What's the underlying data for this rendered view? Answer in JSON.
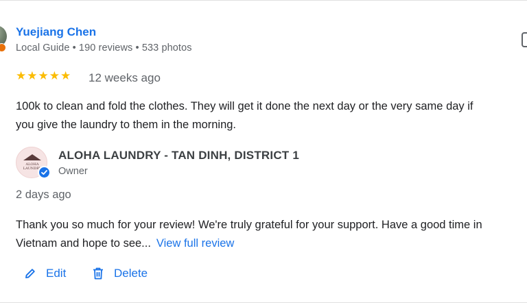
{
  "reviewer": {
    "name": "Yuejiang Chen",
    "meta": "Local Guide • 190 reviews • 533 photos"
  },
  "review": {
    "stars": "★★★★★",
    "rating": 5,
    "time": "12 weeks ago",
    "text_line1": "100k to clean and fold the clothes. They will get it done the next day or the very same day if",
    "text_line2": "you give the laundry to them in the morning."
  },
  "owner_reply": {
    "name": "ALOHA LAUNDRY - TAN DINH, DISTRICT 1",
    "role": "Owner",
    "logo_text": "ALOHA LAUNDRY",
    "time": "2 days ago",
    "text_line1": "Thank you so much for your review! We're truly grateful for your support. Have a good time in",
    "text_line2": "Vietnam and hope to see...",
    "view_full_label": "View full review"
  },
  "actions": {
    "edit_label": "Edit",
    "delete_label": "Delete"
  },
  "colors": {
    "link": "#1a73e8",
    "star": "#fbbc04",
    "guide_badge": "#e8710a"
  },
  "icons": [
    "local-guide-icon",
    "more-icon",
    "verified-icon",
    "pencil-icon",
    "trash-icon"
  ]
}
